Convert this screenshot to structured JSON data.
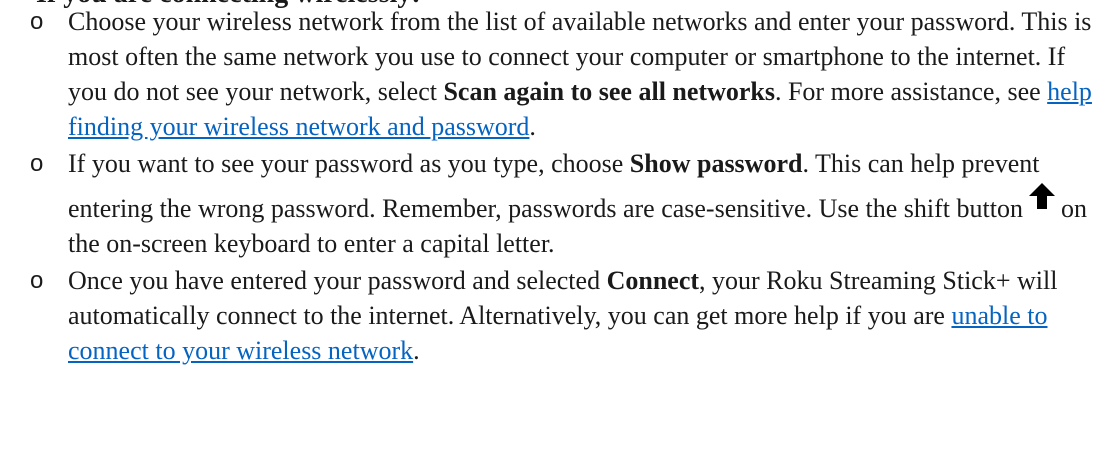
{
  "heading": {
    "text": "If you are connecting wirelessly:"
  },
  "bullet_glyph": "o",
  "steps": [
    {
      "text_1": "Choose your wireless network from the list of available networks and enter your password. This is most often the same network you use to connect your computer or smartphone to the internet. If you do not see your network, select ",
      "bold_1": "Scan again to see all networks",
      "text_2": ". For more assistance, see ",
      "link_1": "help finding your wireless network and password",
      "text_3": "."
    },
    {
      "text_1": "If you want to see your password as you type, choose ",
      "bold_1": "Show password",
      "text_2": ". This can help prevent entering the wrong password. Remember, passwords are case-sensitive. Use the shift button",
      "icon": "shift-arrow-icon",
      "text_3": "on the on-screen keyboard to enter a capital letter."
    },
    {
      "text_1": "Once you have entered your password and selected ",
      "bold_1": "Connect",
      "text_2": ", your Roku Streaming Stick+ will automatically connect to the internet. Alternatively, you can get more help if you are ",
      "link_1": "unable to connect to your wireless network",
      "text_3": "."
    }
  ]
}
